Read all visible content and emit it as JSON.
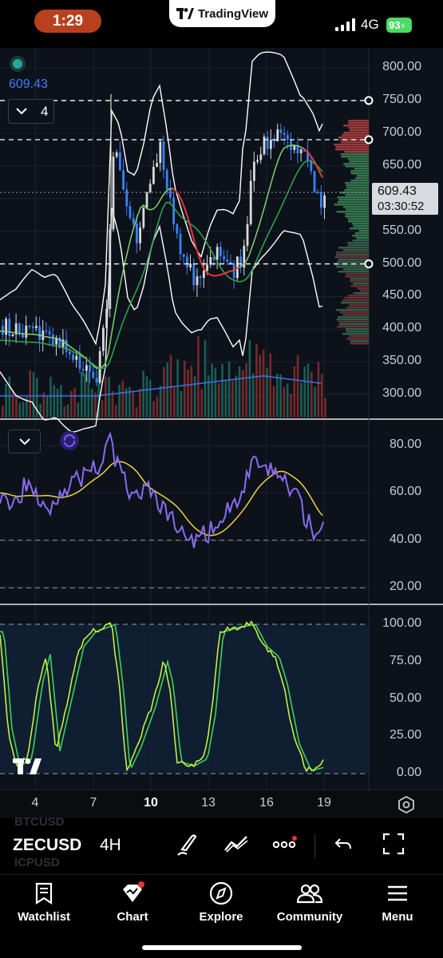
{
  "status_bar": {
    "time": "1:29",
    "network": "4G",
    "battery": "93"
  },
  "app_pill": {
    "label": "TradingView"
  },
  "main_chart": {
    "last_price_top": "609.43",
    "collapse_count": "4",
    "price_badge": "609.43",
    "countdown": "03:30:52",
    "y_ticks": [
      "800.00",
      "750.00",
      "700.00",
      "650.00",
      "600.00",
      "550.00",
      "500.00",
      "450.00",
      "400.00",
      "350.00",
      "300.00"
    ]
  },
  "rsi_pane": {
    "y_ticks": [
      "80.00",
      "60.00",
      "40.00",
      "20.00"
    ]
  },
  "stoch_pane": {
    "y_ticks": [
      "100.00",
      "75.00",
      "50.00",
      "25.00",
      "0.00"
    ]
  },
  "time_axis": {
    "labels": [
      "4",
      "7",
      "10",
      "13",
      "16",
      "19"
    ],
    "bold_label": "10"
  },
  "symbol_bar": {
    "symbol": "ZECUSD",
    "interval": "4H",
    "ghost_above": "BTCUSD",
    "ghost_below": "ICPUSD"
  },
  "nav": {
    "items": [
      "Watchlist",
      "Chart",
      "Explore",
      "Community",
      "Menu"
    ]
  },
  "colors": {
    "up": "#3b82f6",
    "down": "#d9d9d9",
    "rsi": "#8a6cf0",
    "rsi_ma": "#f2d13c",
    "stoch_k": "#c6f03c",
    "stoch_d": "#3dd25a",
    "alert": "#e53935"
  }
}
